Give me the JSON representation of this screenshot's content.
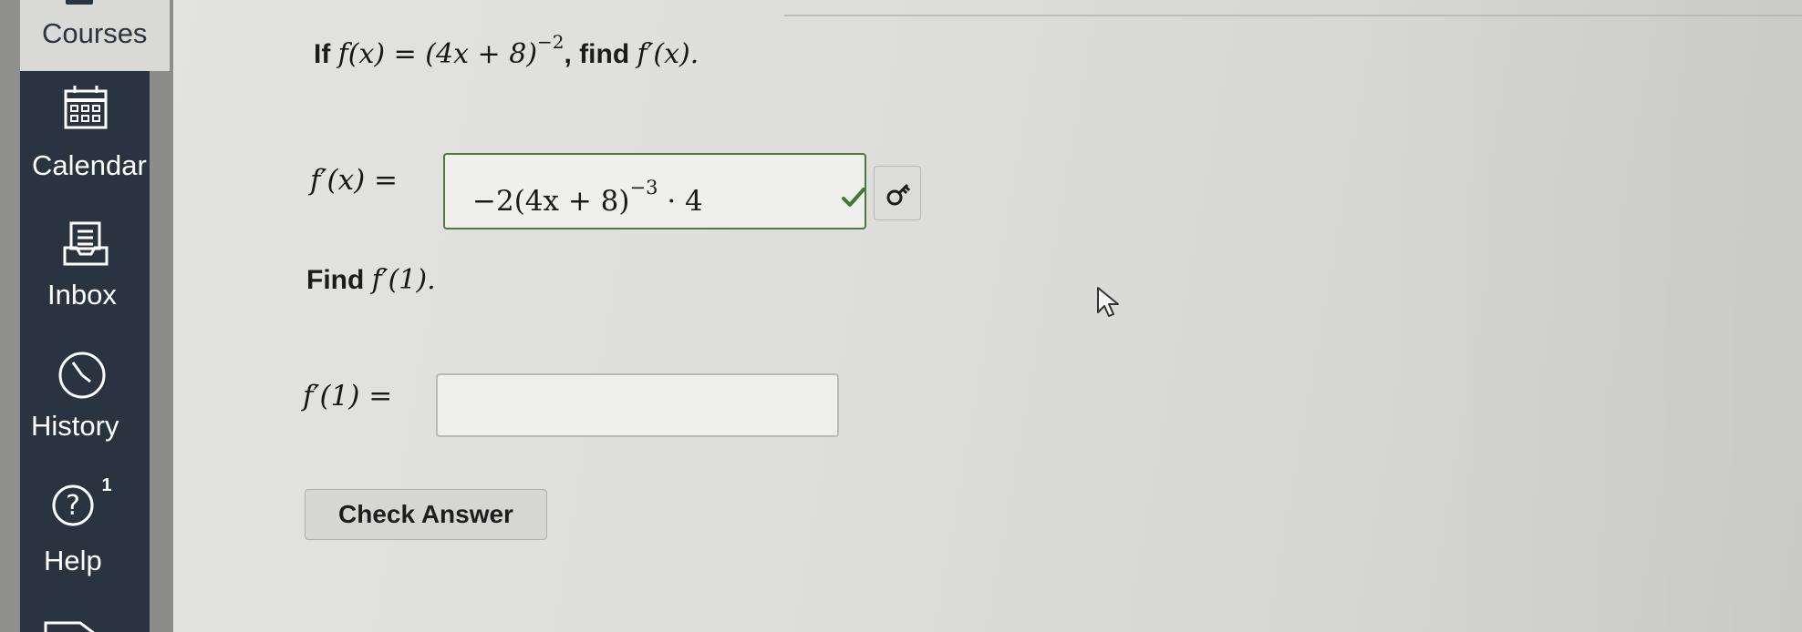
{
  "sidebar": {
    "items": [
      {
        "label": "Courses",
        "icon": "courses-icon"
      },
      {
        "label": "Calendar",
        "icon": "calendar-icon"
      },
      {
        "label": "Inbox",
        "icon": "inbox-icon"
      },
      {
        "label": "History",
        "icon": "history-icon"
      },
      {
        "label": "Help",
        "icon": "help-icon",
        "badge": "1"
      }
    ],
    "colors": {
      "background": "#2a3340",
      "text": "#ffffff"
    }
  },
  "question": {
    "prefix": "If",
    "function_lhs": "f(x) = (4x + 8)",
    "function_exponent": "−2",
    "find_text": ", find",
    "derivative_target": "f′(x).",
    "answer1": {
      "label": "f′(x) =",
      "value_main": "−2(4x + 8)",
      "value_exponent": "−3",
      "value_tail": "· 4",
      "status_icon": "check-icon",
      "status_color": "#3d7a29",
      "key_icon": "key-icon"
    },
    "part2": {
      "prompt_prefix": "Find",
      "prompt_math": "f′(1)."
    },
    "answer2": {
      "label": "f′(1) =",
      "value": ""
    },
    "check_button_label": "Check Answer"
  }
}
